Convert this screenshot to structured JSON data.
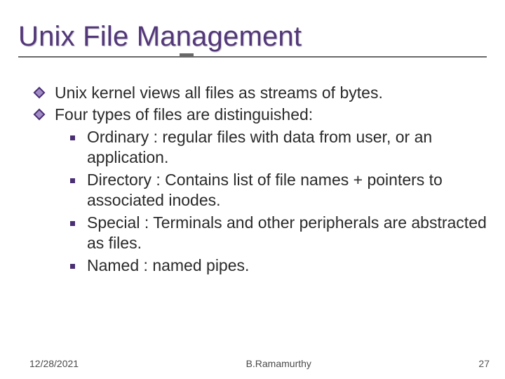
{
  "title": "Unix File Management",
  "points": {
    "p1": "Unix kernel views all files as streams of bytes.",
    "p2": "Four types of files are distinguished:",
    "sub": {
      "s1": "Ordinary : regular files with data from user, or an application.",
      "s2": "Directory : Contains list of file names + pointers to associated inodes.",
      "s3": "Special : Terminals and other peripherals are abstracted as files.",
      "s4": "Named : named pipes."
    }
  },
  "footer": {
    "date": "12/28/2021",
    "author": "B.Ramamurthy",
    "page": "27"
  }
}
